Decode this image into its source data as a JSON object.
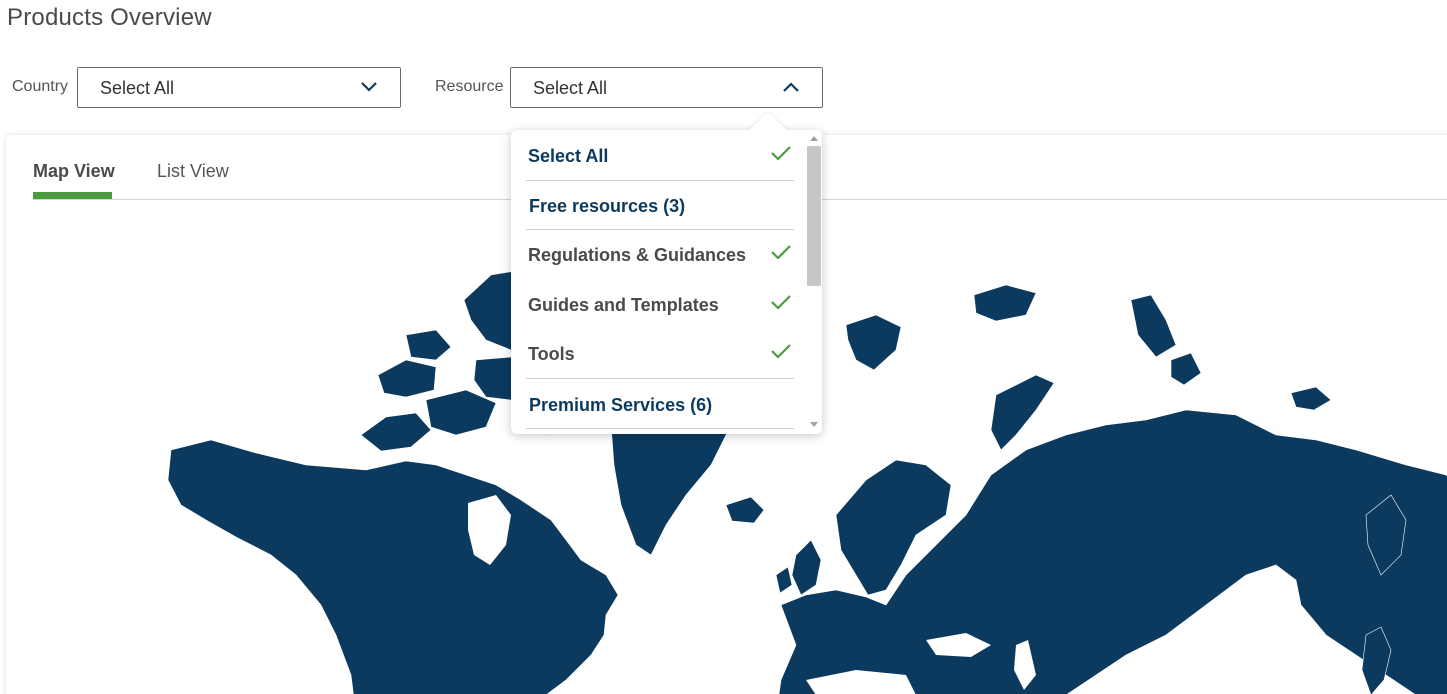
{
  "page": {
    "title": "Products Overview"
  },
  "filters": {
    "country": {
      "label": "Country",
      "value": "Select All"
    },
    "resource": {
      "label": "Resource",
      "value": "Select All"
    }
  },
  "tabs": [
    {
      "label": "Map View",
      "active": true
    },
    {
      "label": "List View",
      "active": false
    }
  ],
  "resource_dropdown": {
    "options": [
      {
        "label": "Select All",
        "checked": true
      },
      {
        "label": "Free resources (3)",
        "checked": false
      },
      {
        "label": "Regulations & Guidances",
        "checked": true
      },
      {
        "label": "Guides and Templates",
        "checked": true
      },
      {
        "label": "Tools",
        "checked": true
      },
      {
        "label": "Premium Services (6)",
        "checked": false
      }
    ]
  },
  "colors": {
    "map_fill": "#0c3a5e",
    "accent_green": "#4c9a3f",
    "option_text": "#0c3a5e"
  },
  "icons": {
    "select_chevron": "chevron-down-icon",
    "open_chevron": "chevron-up-icon",
    "option_check": "check-icon"
  }
}
